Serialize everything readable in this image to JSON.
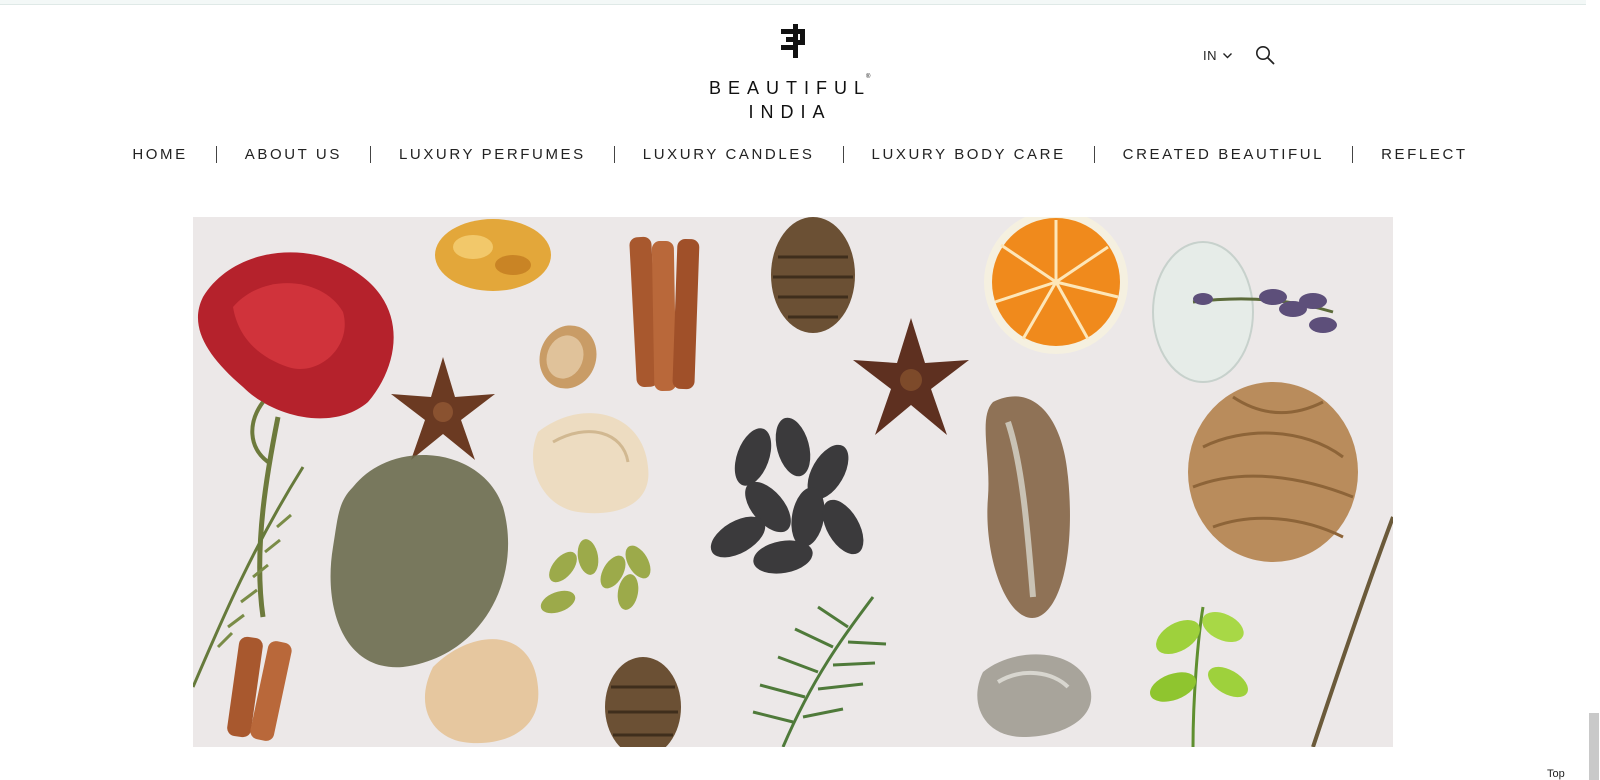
{
  "brand": {
    "line1": "BEAUTIFUL",
    "line2": "INDIA",
    "registered": "®",
    "logo_icon": "beautiful-india-monogram"
  },
  "header": {
    "region_label": "IN",
    "region_icon": "chevron-down-icon",
    "search_icon": "search-icon"
  },
  "nav": {
    "items": [
      {
        "label": "HOME"
      },
      {
        "label": "ABOUT US"
      },
      {
        "label": "LUXURY PERFUMES"
      },
      {
        "label": "LUXURY CANDLES"
      },
      {
        "label": "LUXURY BODY CARE"
      },
      {
        "label": "CREATED BEAUTIFUL"
      },
      {
        "label": "REFLECT"
      }
    ]
  },
  "hero": {
    "background": "#ece8e8",
    "subjects": [
      "red rose",
      "amber resin",
      "cinnamon sticks",
      "pine cones",
      "orange slice",
      "lavender in glass jar",
      "star anise",
      "almond",
      "ground powder",
      "dried petals",
      "tonka beans",
      "tree bark",
      "vetiver roots",
      "cardamom pods",
      "rosemary sprig",
      "mineral stone",
      "green leaf sprig",
      "dry grass stems"
    ]
  },
  "footer": {
    "top_label": "Top"
  },
  "colors": {
    "text": "#222222",
    "accent_bar": "#f3f8f7",
    "scroll_thumb": "#c9c9c9"
  }
}
